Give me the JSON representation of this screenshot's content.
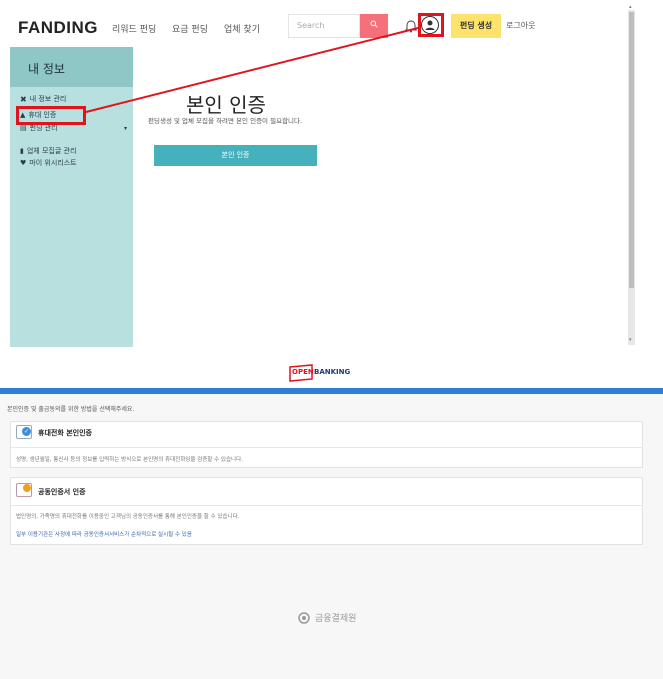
{
  "header": {
    "logo": "FANDING",
    "nav": [
      "리워드 펀딩",
      "요금 펀딩",
      "업체 찾기"
    ],
    "search_placeholder": "Search",
    "create_label": "펀딩 생성",
    "logout_label": "로그아웃"
  },
  "sidebar": {
    "title": "내 정보",
    "items": [
      {
        "label": "내 정보 관리",
        "icon": "tools-icon"
      },
      {
        "label": "휴대 인증",
        "icon": "person-icon"
      },
      {
        "label": "펀딩 관리",
        "icon": "list-icon",
        "has_dropdown": true
      },
      {
        "label": "업체 모집글 관리",
        "icon": "bar-chart-icon"
      },
      {
        "label": "마이 위시리스트",
        "icon": "heart-icon"
      }
    ]
  },
  "main": {
    "title": "본인 인증",
    "description": "펀딩생성 및 업체 모집을 하려면 본인 인증이 필요합니다.",
    "button_label": "본인 인증"
  },
  "openbanking": {
    "logo_prefix": "OPEN",
    "logo_suffix": "BANKING",
    "instruction": "본인인증 및 출금동의를 위한 방법을 선택해주세요.",
    "options": [
      {
        "title": "휴대전화 본인인증",
        "desc": "성명, 생년월일, 통신사 등의 정보를 입력하는 방식으로 본인명의 휴대전화임을 검증할 수 있습니다.",
        "icon": "phone-check-icon"
      },
      {
        "title": "공동인증서 인증",
        "desc": "법인명의, 가족명의 휴대전화를 이용중인 고객님의 공동인증서를 통해 본인인증을 할 수 있습니다.",
        "note": "일부 이용기관은 사정에 따라 공동인증서서비스가 순차적으로 실시될 수 있음",
        "icon": "certificate-icon"
      }
    ],
    "footer_org": "금융결제원"
  },
  "colors": {
    "highlight": "#e1141e",
    "sidebar_bg": "#b7e0df",
    "button": "#45b1bd",
    "create": "#fde26b",
    "bank_blue": "#2f7fd4"
  }
}
